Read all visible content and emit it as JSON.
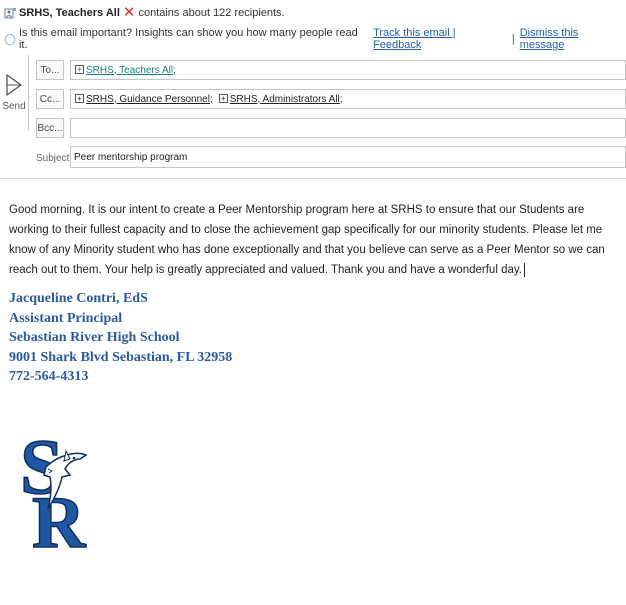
{
  "info_bar": {
    "group_name": "SRHS, Teachers All",
    "recipient_notice": "contains about 122 recipients."
  },
  "insights_bar": {
    "message": "Is this email important? Insights can show you how many people read it.",
    "track_link": "Track this email | Feedback",
    "separator": "|",
    "dismiss_link": "Dismiss this message"
  },
  "compose": {
    "send_label": "Send",
    "to_button": "To...",
    "cc_button": "Cc...",
    "bcc_button": "Bcc...",
    "to_recipients": [
      "SRHS, Teachers All;"
    ],
    "cc_recipients": [
      "SRHS, Guidance Personnel;",
      "SRHS, Administrators All;"
    ],
    "bcc_value": "",
    "subject_label": "Subject",
    "subject_value": "Peer mentorship program"
  },
  "message": {
    "body": "Good morning. It is our intent to create a Peer Mentorship program here at SRHS to ensure that our Students are working to their fullest capacity and to close the achievement gap specifically for our minority students. Please let me know of any Minority student who has done exceptionally and that you believe can serve as a Peer Mentor so we can reach out to them. Your help is greatly appreciated and valued. Thank you and have a wonderful day.",
    "signature": {
      "name": "Jacqueline Contri, EdS",
      "title": "Assistant Principal",
      "school": "Sebastian River High School",
      "address": "9001 Shark Blvd  Sebastian, FL 32958",
      "phone": "772-564-4313"
    },
    "logo": {
      "letters": "SR",
      "primary_color": "#1f57a3",
      "icon": "shark-logo-icon"
    }
  },
  "colors": {
    "link": "#1f5fa8",
    "signature": "#2b5b9e",
    "error_x": "#d13438"
  }
}
